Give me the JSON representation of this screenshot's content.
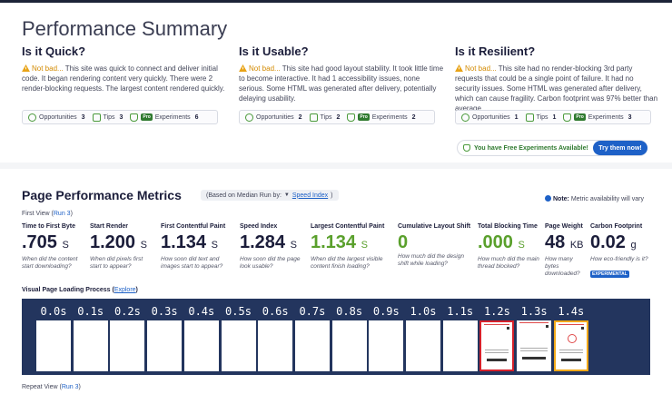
{
  "summary": {
    "title": "Performance Summary",
    "columns": [
      {
        "heading": "Is it Quick?",
        "status": "Not bad...",
        "text": " This site was quick to connect and deliver initial code. It began rendering content very quickly. There were 2 render-blocking requests. The largest content rendered quickly.",
        "opportunities_label": "Opportunities",
        "opportunities": "3",
        "tips_label": "Tips",
        "tips": "3",
        "pro": "Pro",
        "experiments_label": "Experiments",
        "experiments": "6"
      },
      {
        "heading": "Is it Usable?",
        "status": "Not bad...",
        "text": " This site had good layout stability. It took little time to become interactive. It had 1 accessibility issues, none serious. Some HTML was generated after delivery, potentially delaying usability.",
        "opportunities_label": "Opportunities",
        "opportunities": "2",
        "tips_label": "Tips",
        "tips": "2",
        "pro": "Pro",
        "experiments_label": "Experiments",
        "experiments": "2"
      },
      {
        "heading": "Is it Resilient?",
        "status": "Not bad...",
        "text": " This site had no render-blocking 3rd party requests that could be a single point of failure. It had no security issues. Some HTML was generated after delivery, which can cause fragility. Carbon footprint was 97% better than average.",
        "opportunities_label": "Opportunities",
        "opportunities": "1",
        "tips_label": "Tips",
        "tips": "1",
        "pro": "Pro",
        "experiments_label": "Experiments",
        "experiments": "3"
      }
    ],
    "free_banner": "You have Free Experiments Available!",
    "try_button": "Try them now!"
  },
  "metrics": {
    "title": "Page Performance Metrics",
    "median_prefix": "(Based on Median Run by:",
    "median_link": "Speed Index",
    "median_suffix": ")",
    "note_label": "Note:",
    "note_text": " Metric availability will vary",
    "first_view_prefix": "First View (",
    "first_view_link": "Run 3",
    "first_view_suffix": ")",
    "items": [
      {
        "label": "Time to First Byte",
        "value": ".705",
        "unit": "S",
        "desc": "When did the content start downloading?"
      },
      {
        "label": "Start Render",
        "value": "1.200",
        "unit": "S",
        "desc": "When did pixels first start to appear?"
      },
      {
        "label": "First Contentful Paint",
        "value": "1.134",
        "unit": "S",
        "desc": "How soon did text and images start to appear?"
      },
      {
        "label": "Speed Index",
        "value": "1.284",
        "unit": "S",
        "desc": "How soon did the page look usable?"
      },
      {
        "label": "Largest Contentful Paint",
        "value": "1.134",
        "unit": "S",
        "desc": "When did the largest visible content finish loading?"
      },
      {
        "label": "Cumulative Layout Shift",
        "value": "0",
        "unit": "",
        "desc": "How much did the design shift while loading?"
      },
      {
        "label": "Total Blocking Time",
        "value": ".000",
        "unit": "S",
        "desc": "How much did the main thread blocked?"
      },
      {
        "label": "Page Weight",
        "value": "48",
        "unit": "KB",
        "desc": "How many bytes downloaded?"
      },
      {
        "label": "Carbon Footprint",
        "value": "0.02",
        "unit": "g",
        "desc": "How eco-friendly is it?",
        "badge": "EXPERIMENTAL"
      }
    ]
  },
  "filmstrip": {
    "label": "Visual Page Loading Process",
    "explore_link": "Explore",
    "frames": [
      "0.0s",
      "0.1s",
      "0.2s",
      "0.3s",
      "0.4s",
      "0.5s",
      "0.6s",
      "0.7s",
      "0.8s",
      "0.9s",
      "1.0s",
      "1.1s",
      "1.2s",
      "1.3s",
      "1.4s"
    ]
  },
  "repeat_view": {
    "prefix": "Repeat View (",
    "link": "Run 3",
    "suffix": ")"
  },
  "colors": {
    "accent": "#1e61c7",
    "warning": "#d38a00",
    "good": "#5aa02c",
    "filmstrip_bg": "#23355e"
  }
}
